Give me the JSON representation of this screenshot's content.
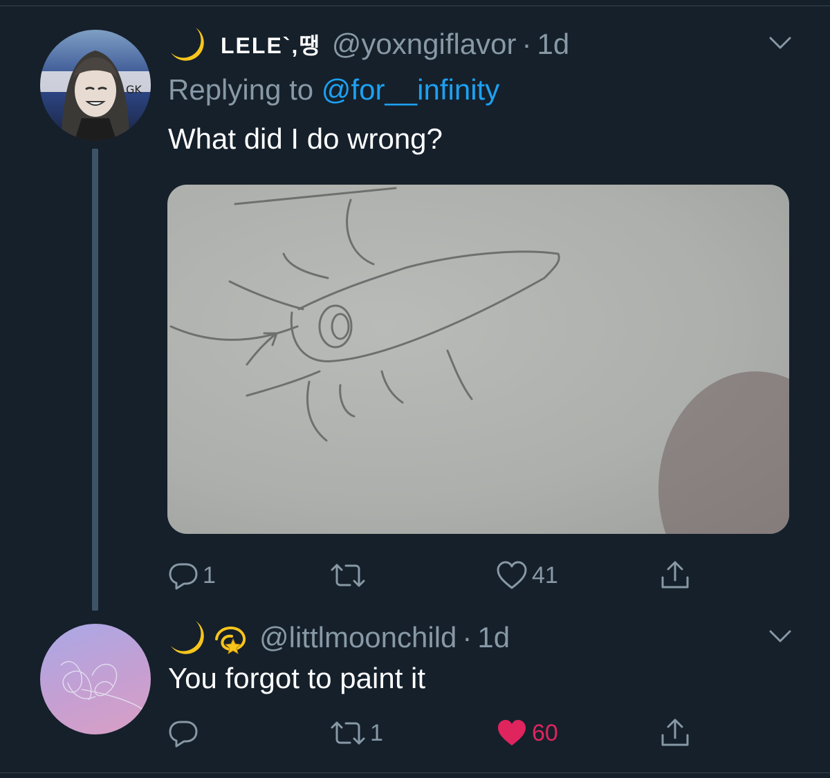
{
  "tweets": [
    {
      "display_name": "LELE`,땡",
      "handle": "@yoxngiflavor",
      "separator": "·",
      "time": "1d",
      "replying_prefix": "Replying to",
      "replying_to": "@for__infinity",
      "text": "What did I do wrong?",
      "emojis": [
        "crescent-moon"
      ],
      "stats": {
        "replies": "1",
        "retweets": "",
        "likes": "41"
      },
      "liked": false
    },
    {
      "display_name": "",
      "handle": "@littlmoonchild",
      "separator": "·",
      "time": "1d",
      "text": "You forgot to paint it",
      "emojis": [
        "crescent-moon",
        "dizzy"
      ],
      "stats": {
        "replies": "",
        "retweets": "1",
        "likes": "60"
      },
      "liked": true
    }
  ],
  "colors": {
    "background": "#15202b",
    "secondary_text": "#8899a6",
    "link": "#1da1f2",
    "like_active": "#e0245e"
  }
}
